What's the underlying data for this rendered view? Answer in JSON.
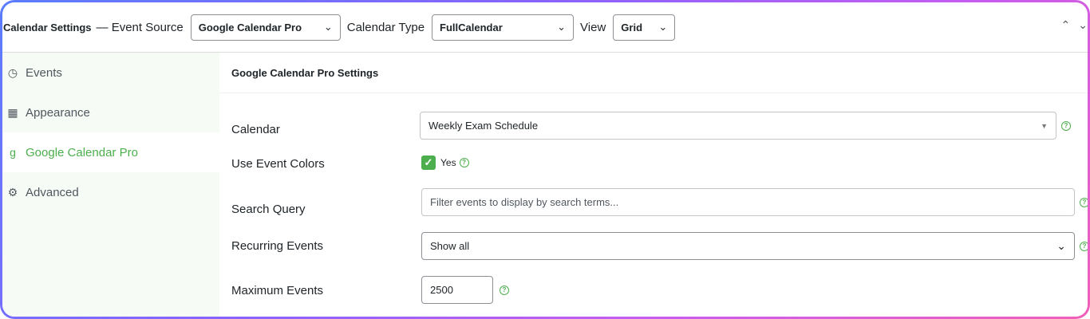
{
  "header": {
    "title": "Calendar Settings",
    "event_source_label": "— Event Source",
    "event_source_value": "Google Calendar Pro",
    "calendar_type_label": "Calendar Type",
    "calendar_type_value": "FullCalendar",
    "view_label": "View",
    "view_value": "Grid"
  },
  "sidebar": {
    "items": [
      {
        "label": "Events",
        "icon": "clock-icon"
      },
      {
        "label": "Appearance",
        "icon": "calendar-icon"
      },
      {
        "label": "Google Calendar Pro",
        "icon": "google-icon"
      },
      {
        "label": "Advanced",
        "icon": "cogs-icon"
      }
    ],
    "active_index": 2
  },
  "main": {
    "section_title": "Google Calendar Pro Settings",
    "fields": {
      "calendar": {
        "label": "Calendar",
        "value": "Weekly Exam Schedule"
      },
      "use_event_colors": {
        "label": "Use Event Colors",
        "checked": true,
        "check_label": "Yes"
      },
      "search_query": {
        "label": "Search Query",
        "placeholder": "Filter events to display by search terms..."
      },
      "recurring_events": {
        "label": "Recurring Events",
        "value": "Show all"
      },
      "maximum_events": {
        "label": "Maximum Events",
        "value": "2500"
      }
    }
  },
  "colors": {
    "accent": "#4cae4c",
    "sidebar_bg": "#f6fbf5",
    "border": "#8c8f94"
  }
}
